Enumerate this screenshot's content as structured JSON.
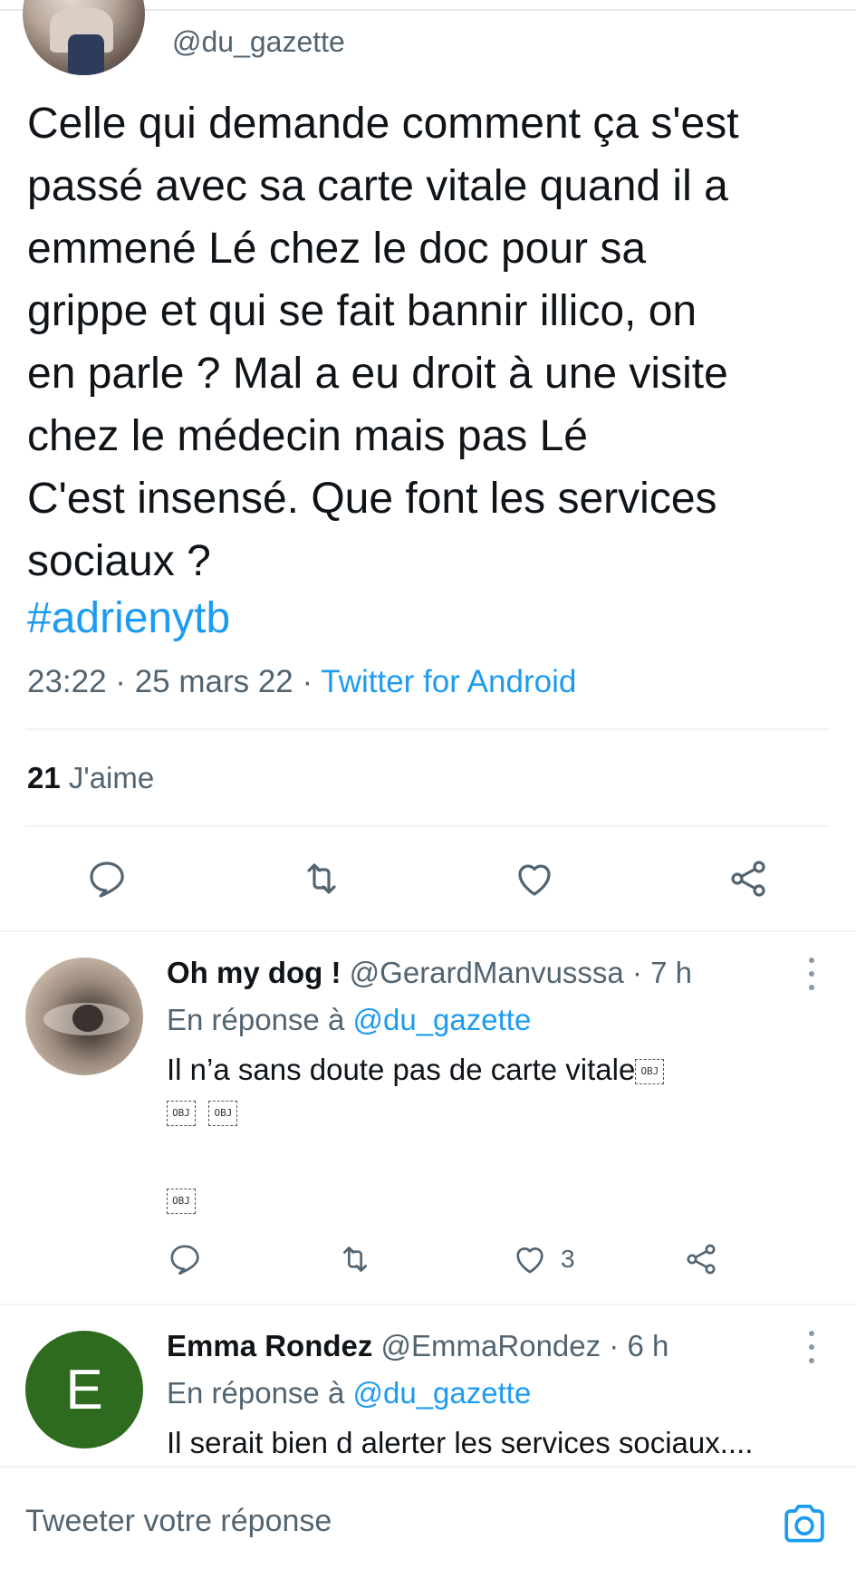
{
  "tweet": {
    "handle": "@du_gazette",
    "text": "Celle qui demande comment ça s'est\npassé avec sa carte vitale quand il a\nemmené Lé chez le doc pour sa\ngrippe et qui se fait bannir illico, on\nen parle ? Mal a eu droit à une visite\nchez le médecin mais pas Lé\nC'est insensé. Que font les services\nsociaux ?",
    "hashtag": "#adrienytb",
    "time": "23:22 · 25 mars 22 · ",
    "source": "Twitter for Android",
    "likes_count": "21",
    "likes_label": " J'aime"
  },
  "replies": [
    {
      "name": "Oh my dog !",
      "handle": " @GerardManvusssa · 7 h",
      "reply_prefix": "En réponse à ",
      "reply_to": "@du_gazette",
      "text": "Il n’a sans doute pas de carte vitale",
      "obj_label": "OBJ",
      "like_count": "3"
    },
    {
      "name": "Emma Rondez",
      "handle": " @EmmaRondez · 6 h",
      "reply_prefix": "En réponse à ",
      "reply_to": "@du_gazette",
      "text": "Il serait bien d alerter les services sociaux....",
      "avatar_letter": "E"
    }
  ],
  "compose": {
    "placeholder": "Tweeter votre réponse"
  },
  "colors": {
    "accent": "#1d9bf0",
    "text": "#0f1419",
    "secondary": "#536471",
    "avatar_green": "#2f6b1e"
  }
}
